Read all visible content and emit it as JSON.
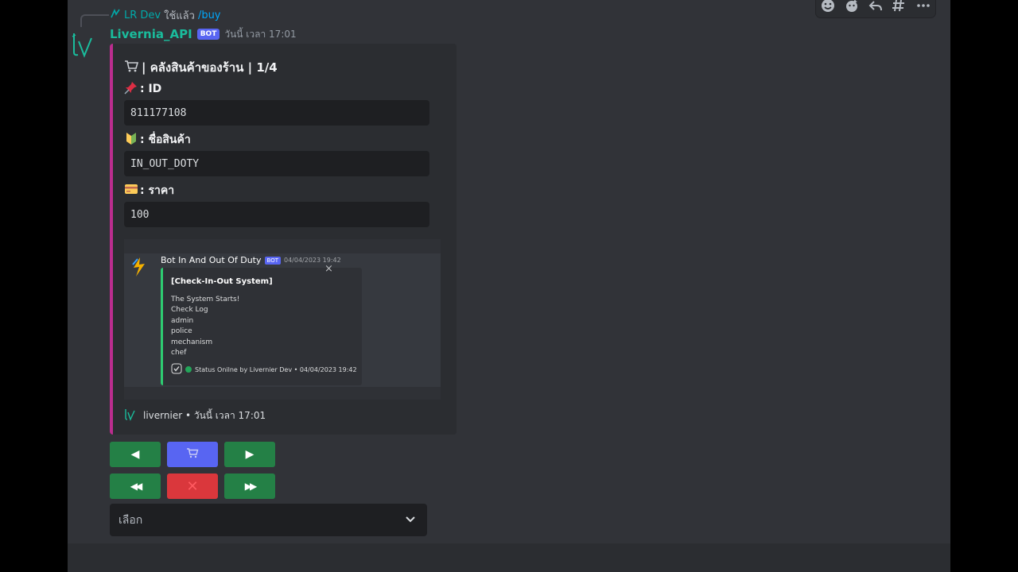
{
  "reply": {
    "user": "LR Dev",
    "action_text": "ใช้แล้ว",
    "command": "/buy"
  },
  "message": {
    "author": "Livernia_API",
    "bot_tag": "BOT",
    "timestamp": "วันนี้ เวลา 17:01",
    "accent_color": "#bb2d8e"
  },
  "embed": {
    "title": "| คลังสินค้าของร้าน | 1/4",
    "title_icon": "shopping-cart-icon",
    "fields": [
      {
        "name": ": ID",
        "icon": "pushpin-icon",
        "value": "811177108"
      },
      {
        "name": ": ชื่อสินค้า",
        "icon": "beginner-symbol-icon",
        "value": "IN_OUT_DOTY"
      },
      {
        "name": ": ราคา",
        "icon": "credit-card-icon",
        "value": "100"
      }
    ],
    "footer": "livernier • วันนี้ เวลา 17:01"
  },
  "embed_image": {
    "bot_name": "Bot In And Out Of Duty",
    "bot_tag": "BOT",
    "timestamp": "04/04/2023 19:42",
    "title": "[Check-In-Out System]",
    "lines": [
      "The System Starts!",
      "Check Log",
      "admin",
      "police",
      "mechanism",
      "chef"
    ],
    "footer": "Status Onilne by Livernier Dev • 04/04/2023 19:42",
    "accent_color": "#2ecc71",
    "close_glyph": "×"
  },
  "buttons": {
    "prev": "◀",
    "cart": "🛒",
    "next": "▶",
    "first": "◀◀",
    "close": "✕",
    "last": "▶▶"
  },
  "select": {
    "placeholder": "เลือก"
  }
}
